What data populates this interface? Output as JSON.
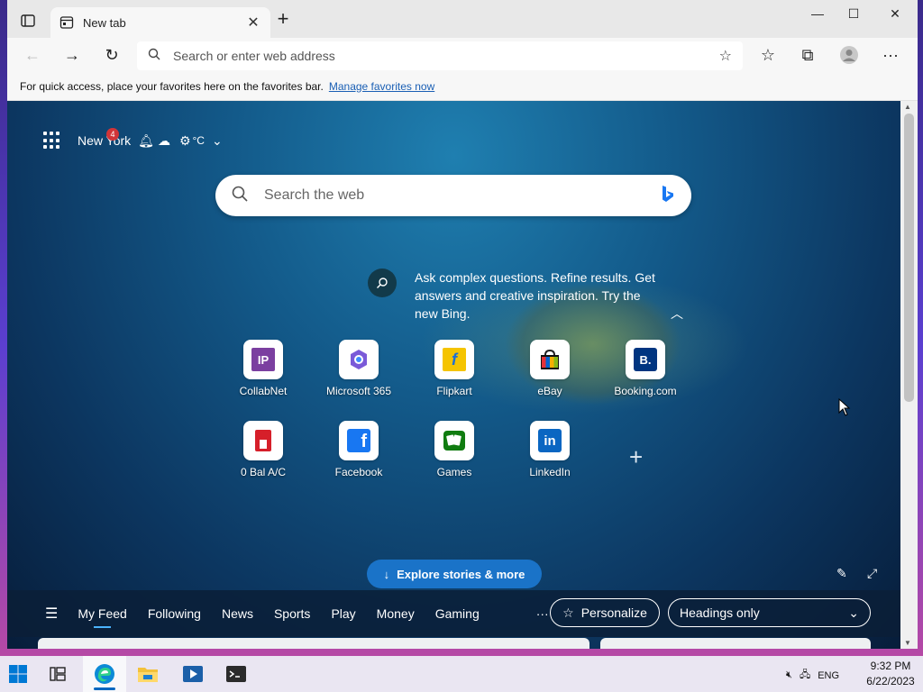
{
  "browser": {
    "tab_title": "New tab",
    "address_placeholder": "Search or enter web address",
    "favorites_bar_text": "For quick access, place your favorites here on the favorites bar.",
    "favorites_bar_link": "Manage favorites now"
  },
  "newtab": {
    "location": "New York",
    "notification_count": "4",
    "temperature_unit": "°C",
    "search_placeholder": "Search the web",
    "bing_promo": "Ask complex questions. Refine results. Get answers and creative inspiration. Try the new Bing.",
    "quick_links": [
      {
        "label": "CollabNet",
        "icon": "IP",
        "color": "#7b3fa0"
      },
      {
        "label": "Microsoft 365",
        "icon": "M365",
        "color": "#6a4cc2"
      },
      {
        "label": "Flipkart",
        "icon": "f",
        "color": "#f5c400"
      },
      {
        "label": "eBay",
        "icon": "bag",
        "color": "#e53238"
      },
      {
        "label": "Booking.com",
        "icon": "B.",
        "color": "#003580"
      },
      {
        "label": "0 Bal A/C",
        "icon": "kotak",
        "color": "#d61f2a"
      },
      {
        "label": "Facebook",
        "icon": "f",
        "color": "#1877f2"
      },
      {
        "label": "Games",
        "icon": "cards",
        "color": "#107c10"
      },
      {
        "label": "LinkedIn",
        "icon": "in",
        "color": "#0a66c2"
      }
    ],
    "explore_label": "Explore stories & more",
    "feed_tabs": [
      "My Feed",
      "Following",
      "News",
      "Sports",
      "Play",
      "Money",
      "Gaming"
    ],
    "more_label": "···",
    "personalize_label": "Personalize",
    "layout_select": "Headings only"
  },
  "taskbar": {
    "language": "ENG",
    "time": "9:32 PM",
    "date": "6/22/2023"
  }
}
